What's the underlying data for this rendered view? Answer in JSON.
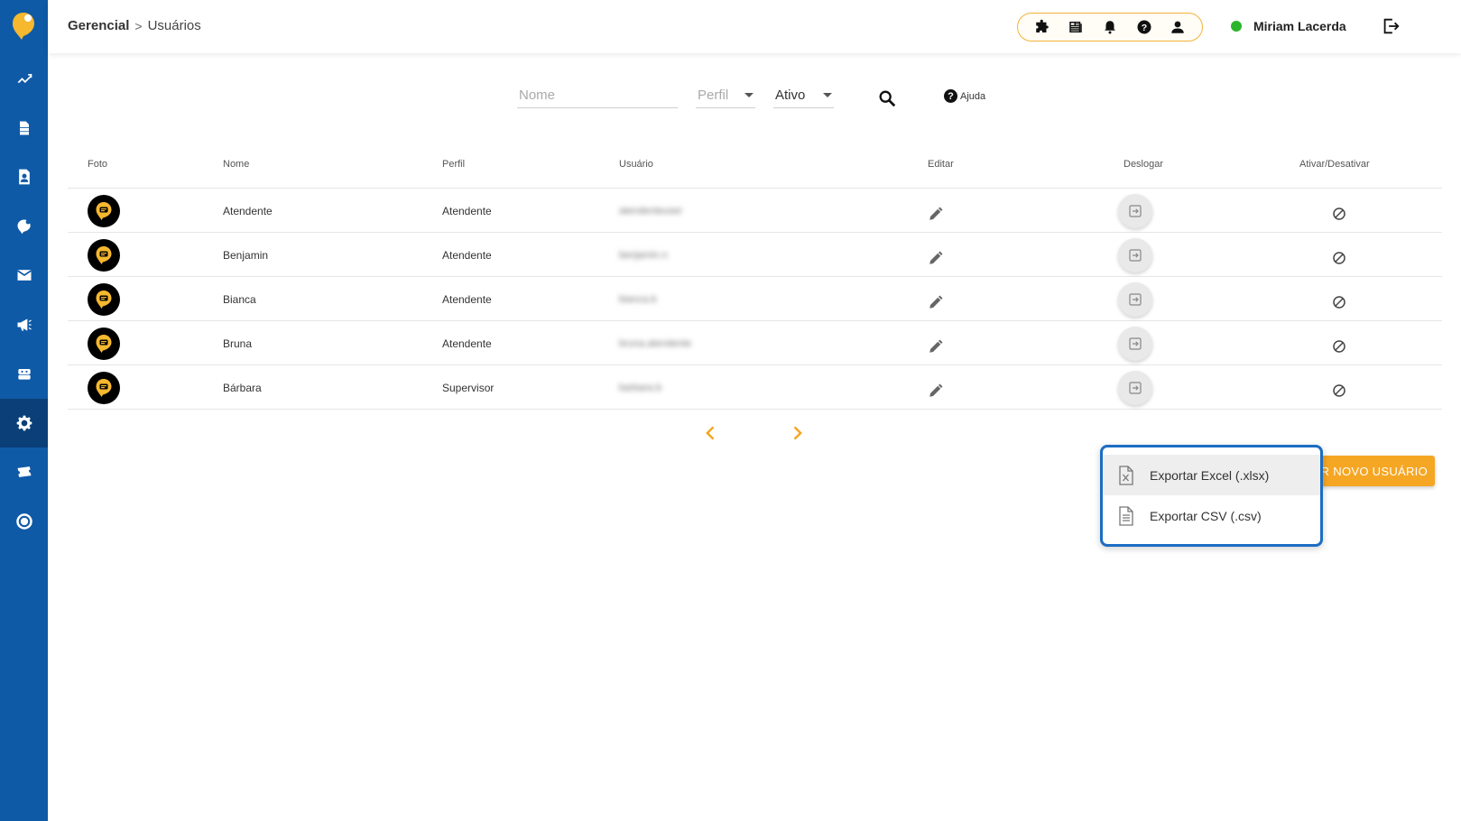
{
  "breadcrumb": {
    "section": "Gerencial",
    "page": "Usuários"
  },
  "user": {
    "name": "Miriam Lacerda",
    "status_color": "#2db52d"
  },
  "colors": {
    "sidebar": "#0e5aa7",
    "accent": "#f5a623",
    "menu_border": "#1c6dc3"
  },
  "sidebar": {
    "items": [
      {
        "icon": "trending-up-icon"
      },
      {
        "icon": "stack-icon"
      },
      {
        "icon": "contact-card-icon"
      },
      {
        "icon": "chat-bubble-icon"
      },
      {
        "icon": "mail-icon"
      },
      {
        "icon": "megaphone-icon"
      },
      {
        "icon": "robot-icon"
      },
      {
        "icon": "gear-icon",
        "active": true
      },
      {
        "icon": "ticket-icon"
      },
      {
        "icon": "nps-icon"
      }
    ]
  },
  "quick_actions": [
    "puzzle-icon",
    "news-icon",
    "bell-icon",
    "help-icon",
    "person-icon"
  ],
  "filters": {
    "name_placeholder": "Nome",
    "perfil_label": "Perfil",
    "status_value": "Ativo",
    "help_label": "Ajuda"
  },
  "table": {
    "headers": {
      "foto": "Foto",
      "nome": "Nome",
      "perfil": "Perfil",
      "usuario": "Usuário",
      "editar": "Editar",
      "deslogar": "Deslogar",
      "ativar": "Ativar/Desativar"
    },
    "rows": [
      {
        "nome": "Atendente",
        "perfil": "Atendente",
        "usuario": "atendenteuser"
      },
      {
        "nome": "Benjamin",
        "perfil": "Atendente",
        "usuario": "benjamin.n"
      },
      {
        "nome": "Bianca",
        "perfil": "Atendente",
        "usuario": "bianca.b"
      },
      {
        "nome": "Bruna",
        "perfil": "Atendente",
        "usuario": "bruna.atendente"
      },
      {
        "nome": "Bárbara",
        "perfil": "Supervisor",
        "usuario": "barbara.b"
      }
    ]
  },
  "actions": {
    "new_user_label": "AR NOVO USUÁRIO"
  },
  "export_menu": {
    "items": [
      {
        "label": "Exportar Excel (.xlsx)",
        "icon": "excel-file-icon"
      },
      {
        "label": "Exportar CSV (.csv)",
        "icon": "document-icon"
      }
    ]
  }
}
